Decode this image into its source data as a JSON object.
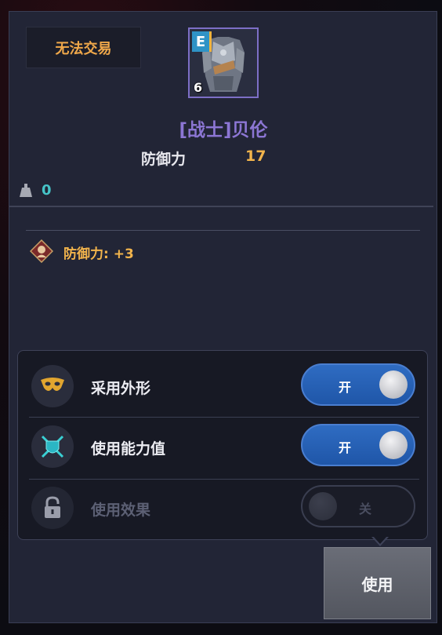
{
  "item": {
    "tradeable_label": "无法交易",
    "grade": "E",
    "enhance_level": "6",
    "name": "[战士]贝伦",
    "stat_label": "防御力",
    "stat_value": "17",
    "weight_value": "0",
    "bonus_text": "防御力: +3",
    "icon": "armor-icon"
  },
  "options": [
    {
      "label": "采用外形",
      "toggle": "开",
      "enabled": true,
      "state": "on",
      "icon": "mask-icon"
    },
    {
      "label": "使用能力值",
      "toggle": "开",
      "enabled": true,
      "state": "on",
      "icon": "crossed-swords-shield-icon"
    },
    {
      "label": "使用效果",
      "toggle": "关",
      "enabled": false,
      "state": "off",
      "icon": "lock-icon"
    }
  ],
  "use_button": "使用",
  "colors": {
    "grade_badge": "#2f93c6",
    "item_name": "#8c76d4",
    "stat_value": "#f2b44c",
    "weight_value": "#46c4c8",
    "toggle_on": "#2f6cc2"
  }
}
